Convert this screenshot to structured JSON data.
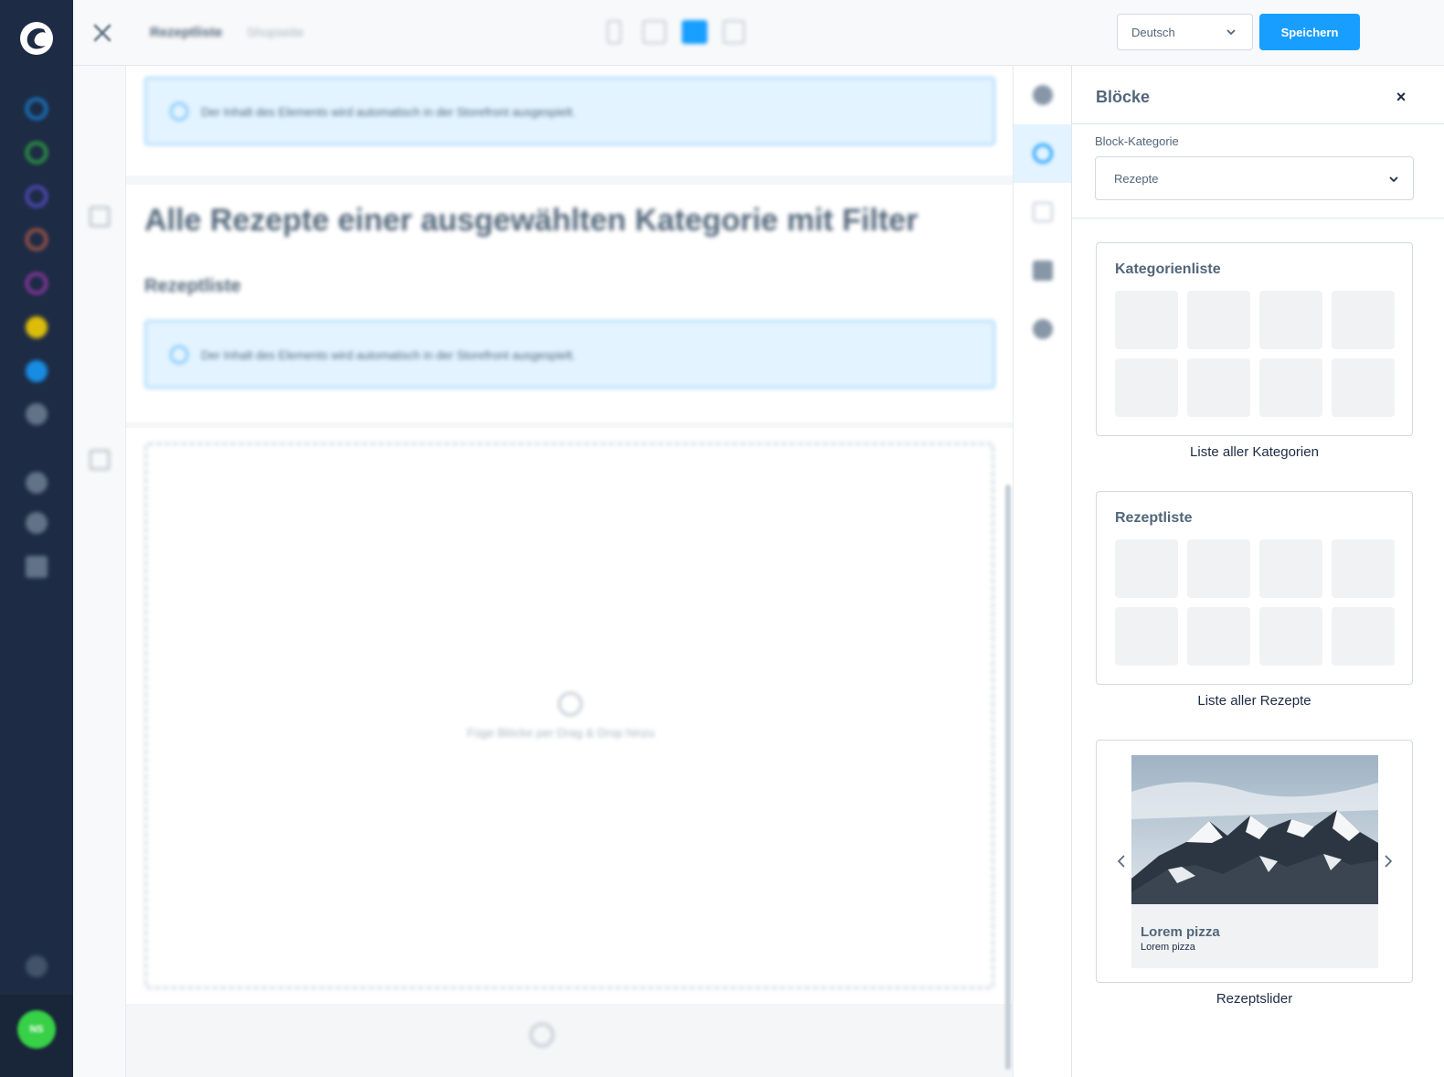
{
  "topbar": {
    "close_label": "",
    "breadcrumb_title": "Rezeptliste",
    "breadcrumb_sub": "Shopseite",
    "language_value": "Deutsch",
    "save_label": "Speichern"
  },
  "stage": {
    "alert_text_1": "Der Inhalt des Elements wird automatisch in der Storefront ausgespielt.",
    "heading": "Alle Rezepte einer ausgewählten Kategorie mit Filter",
    "subheading": "Rezeptliste",
    "alert_text_2": "Der Inhalt des Elements wird automatisch in der Storefront ausgespielt.",
    "dropzone_text": "Füge Blöcke per Drag & Drop hinzu"
  },
  "user": {
    "initials": "NS"
  },
  "panel": {
    "title": "Blöcke",
    "close_glyph": "×",
    "category_label": "Block-Kategorie",
    "category_value": "Rezepte",
    "blocks": [
      {
        "title": "Kategorienliste",
        "caption": "Liste aller Kategorien"
      },
      {
        "title": "Rezeptliste",
        "caption": "Liste aller Rezepte"
      },
      {
        "title": "",
        "caption": "Rezeptslider",
        "slide_title": "Lorem pizza",
        "slide_sub": "Lorem pizza"
      }
    ]
  },
  "colors": {
    "nav_bg": "#1d2b45",
    "accent": "#189eff",
    "alert_bg": "#e3f3ff",
    "tile_bg": "#f1f2f4"
  },
  "icons": {
    "nav": [
      "dashboard-icon",
      "catalog-icon",
      "orders-icon",
      "customers-icon",
      "content-icon",
      "marketing-icon",
      "extensions-icon",
      "settings-icon",
      "sales-channel-1-icon",
      "sales-channel-2-icon",
      "sales-channel-3-icon",
      "help-icon"
    ],
    "rail": [
      "settings-icon",
      "add-block-icon",
      "edit-icon",
      "layers-icon",
      "share-icon"
    ]
  }
}
